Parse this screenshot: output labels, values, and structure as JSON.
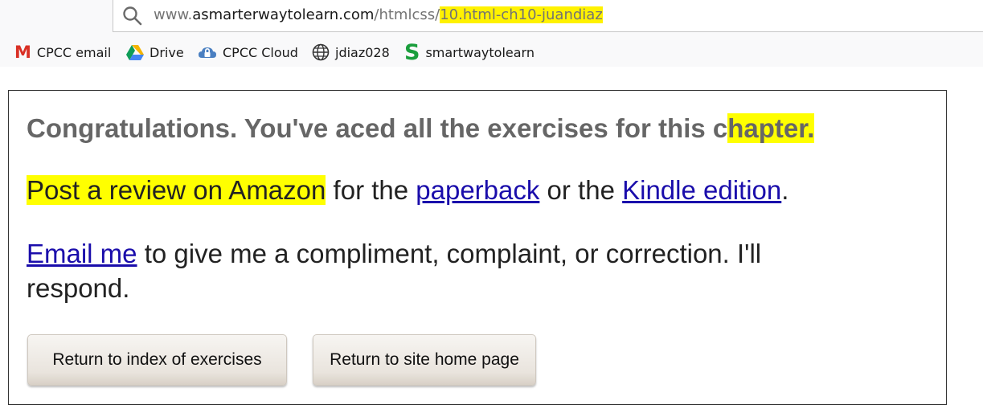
{
  "browser": {
    "url_prefix": "www.",
    "url_domain": "asmarterwaytolearn.com",
    "url_path": "/htmlcss/",
    "url_highlight": "10.html-ch10-juandiaz",
    "bookmarks": [
      {
        "icon": "gmail-icon",
        "glyph": "M",
        "label": "CPCC email"
      },
      {
        "icon": "google-drive-icon",
        "label": "Drive"
      },
      {
        "icon": "lock-cloud-icon",
        "label": "CPCC Cloud"
      },
      {
        "icon": "globe-icon",
        "label": "jdiaz028"
      },
      {
        "icon": "s-logo-icon",
        "glyph": "S",
        "label": "smartwaytolearn"
      }
    ]
  },
  "content": {
    "congrats_main": "Congratulations. You've aced all the exercises for this c",
    "congrats_highlight": "hapter.",
    "review_link": "Post a review on Amazon",
    "review_text1": " for the ",
    "paperback_link": "paperback",
    "review_text2": " or the ",
    "kindle_link": "Kindle edition",
    "review_end": ".",
    "email_link": "Email me",
    "email_text_line1": " to give me a compliment, complaint, or correction. I'll",
    "email_text_line2": "respond.",
    "button_index": "Return to index of exercises",
    "button_home": "Return to site home page"
  },
  "colors": {
    "highlight": "#ffff00",
    "link": "#1a0dab",
    "heading_gray": "#666666"
  }
}
